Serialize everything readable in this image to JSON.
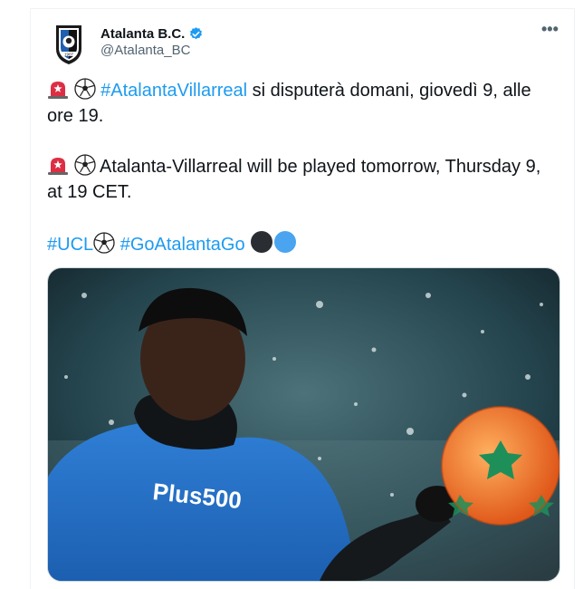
{
  "tweet": {
    "author_name": "Atalanta B.C.",
    "author_handle": "@Atalanta_BC",
    "more_label": "•••",
    "line1_hashtag": "#AtalantaVillarreal",
    "line1_text": " si disputerà domani, giovedì 9, alle ore 19.",
    "line2_text": " Atalanta-Villarreal will be played tomorrow, Thursday 9, at 19 CET.",
    "hashtag_ucl": "#UCL",
    "hashtag_go": "#GoAtalantaGo"
  },
  "colors": {
    "accent": "#1d9bf0",
    "text": "#0f1419",
    "secondary": "#536471",
    "atalanta_black": "#2a2d31",
    "atalanta_blue": "#4aa4f0"
  },
  "icons": [
    "verified-badge-icon",
    "police-light-icon",
    "soccer-ball-icon",
    "black-circle-icon",
    "blue-circle-icon",
    "more-options-icon"
  ],
  "media": {
    "description_kind": "photo"
  }
}
